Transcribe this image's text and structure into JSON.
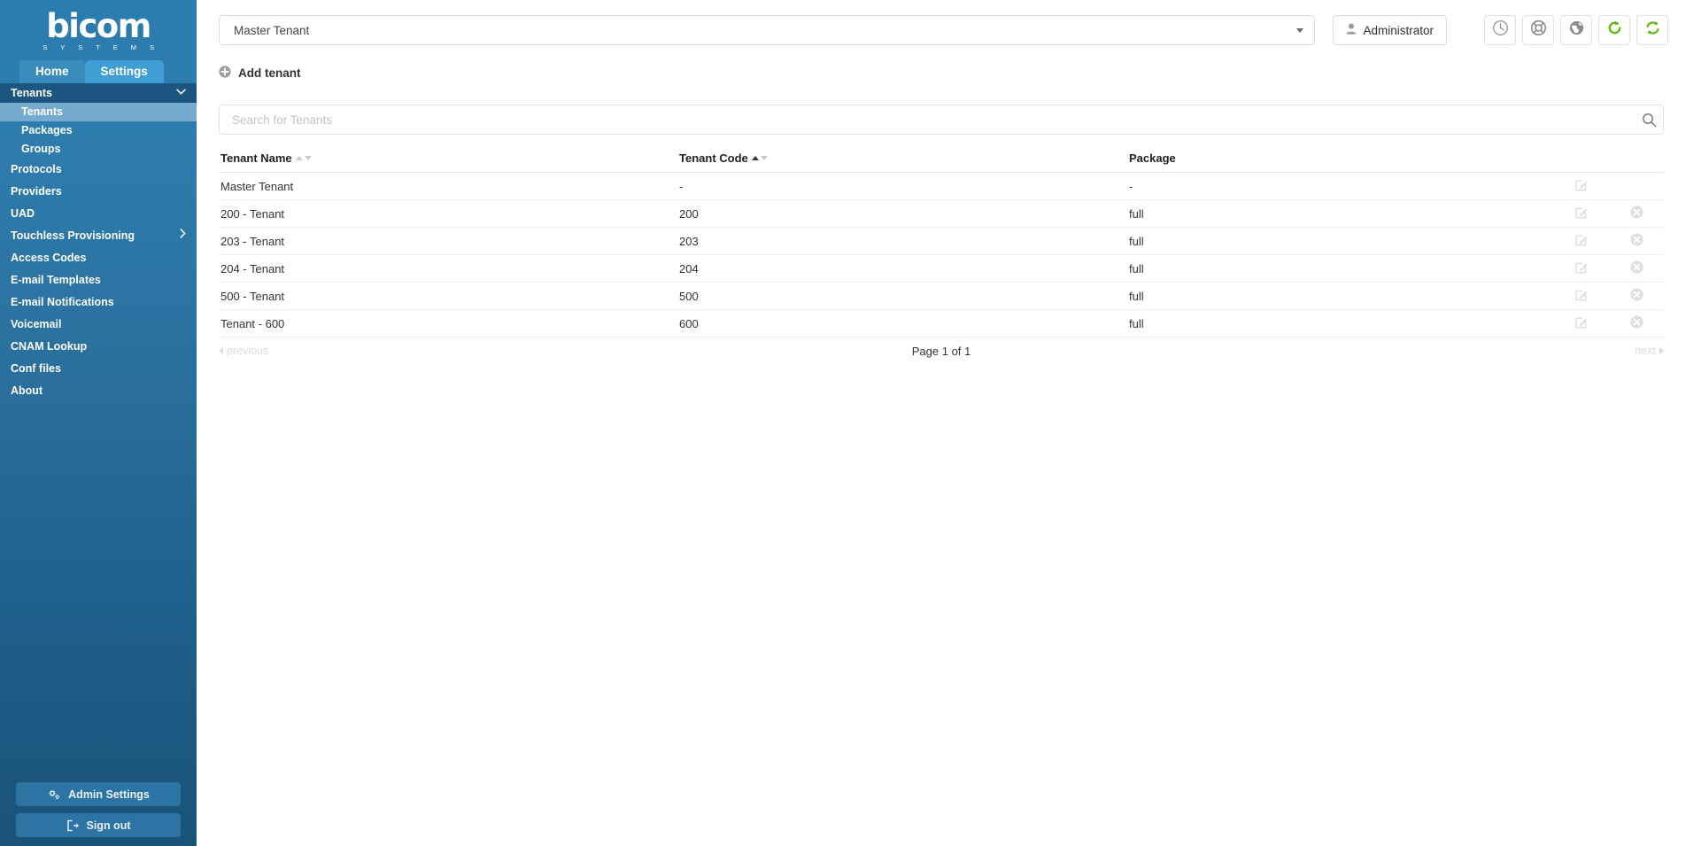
{
  "brand": {
    "logo_word": "bicom",
    "logo_sub": "S Y S T E M S"
  },
  "colors": {
    "sidebar_top": "#2c7cb0",
    "sidebar_bottom": "#1a5378",
    "active_sub": "#76aacf",
    "group_header": "#1c5580",
    "tab_active": "#3e9ed4",
    "refresh_green": "#5cb811"
  },
  "tabs": [
    {
      "label": "Home",
      "active": false
    },
    {
      "label": "Settings",
      "active": true
    }
  ],
  "sidebar": {
    "group": {
      "label": "Tenants",
      "icon": "chevron-down-icon",
      "expanded": true
    },
    "subitems": [
      {
        "label": "Tenants",
        "active": true
      },
      {
        "label": "Packages",
        "active": false
      },
      {
        "label": "Groups",
        "active": false
      }
    ],
    "items": [
      {
        "label": "Protocols",
        "arrow": false
      },
      {
        "label": "Providers",
        "arrow": false
      },
      {
        "label": "UAD",
        "arrow": false
      },
      {
        "label": "Touchless Provisioning",
        "arrow": true
      },
      {
        "label": "Access Codes",
        "arrow": false
      },
      {
        "label": "E-mail Templates",
        "arrow": false
      },
      {
        "label": "E-mail Notifications",
        "arrow": false
      },
      {
        "label": "Voicemail",
        "arrow": false
      },
      {
        "label": "CNAM Lookup",
        "arrow": false
      },
      {
        "label": "Conf files",
        "arrow": false
      },
      {
        "label": "About",
        "arrow": false
      }
    ],
    "bottom_buttons": [
      {
        "label": "Admin Settings",
        "icon": "gears-icon"
      },
      {
        "label": "Sign out",
        "icon": "sign-out-icon"
      }
    ]
  },
  "topbar": {
    "tenant_selected": "Master Tenant",
    "dropdown_icon": "caret-down-icon",
    "user_label": "Administrator",
    "user_icon": "user-icon",
    "icon_buttons": [
      {
        "name": "clock-icon",
        "title": ""
      },
      {
        "name": "life-ring-icon",
        "title": ""
      },
      {
        "name": "globe-icon",
        "title": ""
      },
      {
        "name": "refresh-icon",
        "title": ""
      },
      {
        "name": "sync-icon",
        "title": ""
      }
    ]
  },
  "actions": {
    "add_tenant": "Add tenant",
    "add_icon": "plus-circle-icon"
  },
  "search": {
    "placeholder": "Search for Tenants",
    "value": "",
    "icon": "search-icon"
  },
  "table": {
    "columns": [
      {
        "label": "Tenant Name",
        "sortable": true,
        "sort_state": "inactive"
      },
      {
        "label": "Tenant Code",
        "sortable": true,
        "sort_state": "asc"
      },
      {
        "label": "Package",
        "sortable": false,
        "sort_state": "none"
      }
    ],
    "rows": [
      {
        "name": "Master Tenant",
        "code": "-",
        "package": "-",
        "edit_icon": "edit-icon",
        "delete_icon": null
      },
      {
        "name": "200 - Tenant",
        "code": "200",
        "package": "full",
        "edit_icon": "edit-icon",
        "delete_icon": "delete-icon"
      },
      {
        "name": "203 - Tenant",
        "code": "203",
        "package": "full",
        "edit_icon": "edit-icon",
        "delete_icon": "delete-icon"
      },
      {
        "name": "204 - Tenant",
        "code": "204",
        "package": "full",
        "edit_icon": "edit-icon",
        "delete_icon": "delete-icon"
      },
      {
        "name": "500 - Tenant",
        "code": "500",
        "package": "full",
        "edit_icon": "edit-icon",
        "delete_icon": "delete-icon"
      },
      {
        "name": "Tenant - 600",
        "code": "600",
        "package": "full",
        "edit_icon": "edit-icon",
        "delete_icon": "delete-icon"
      }
    ]
  },
  "pager": {
    "previous": "previous",
    "info": "Page 1 of 1",
    "next": "next"
  }
}
